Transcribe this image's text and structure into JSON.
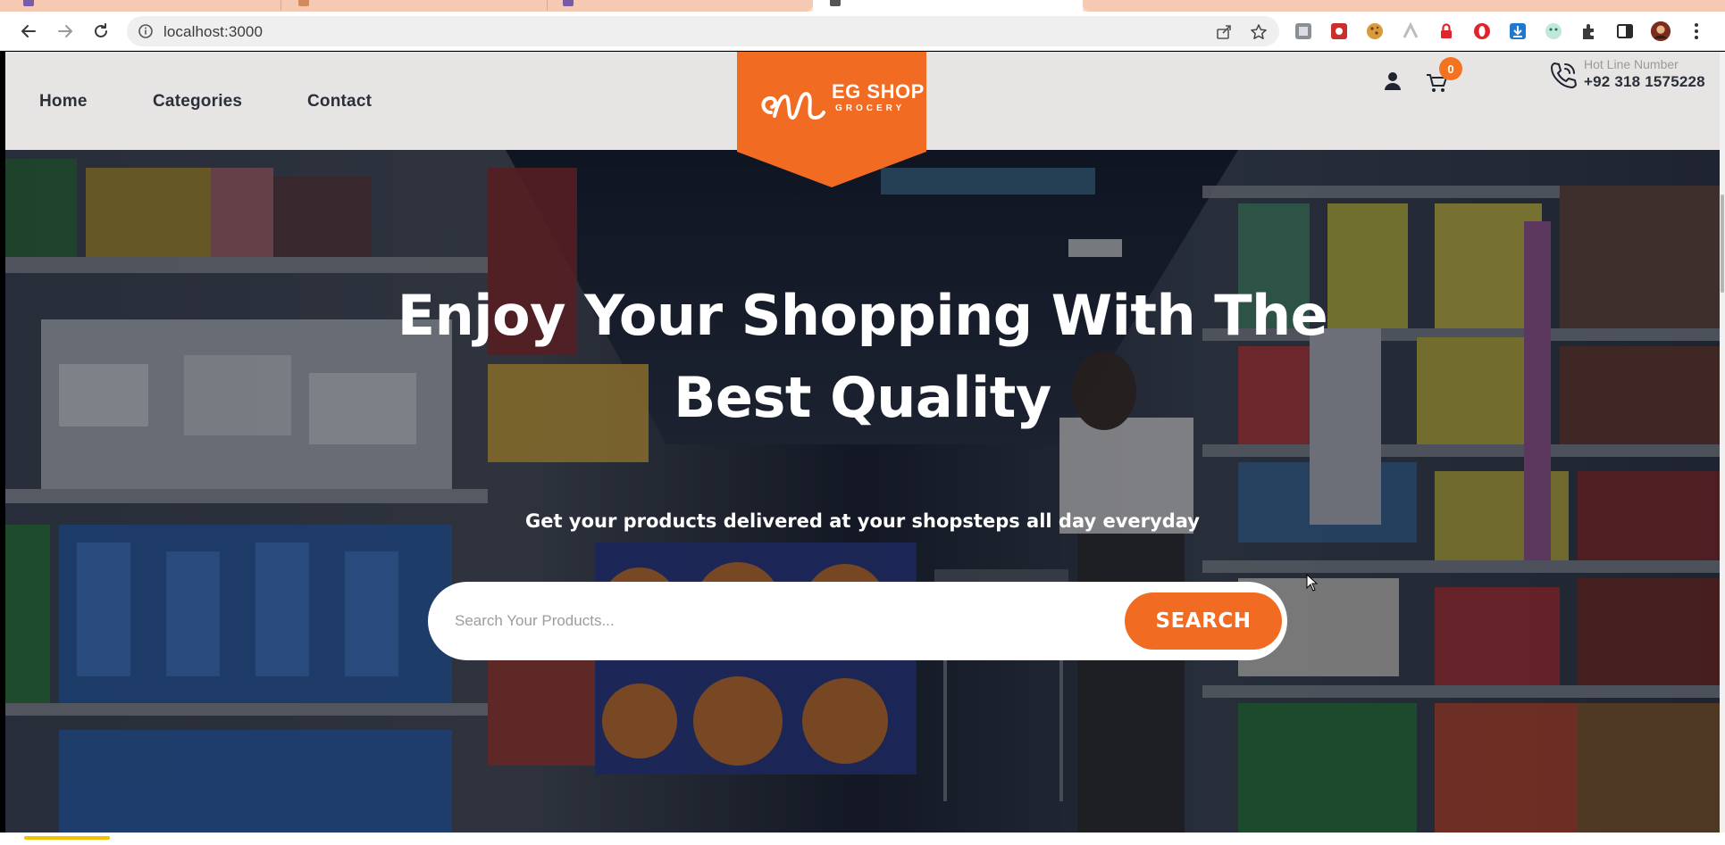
{
  "browser": {
    "url": "localhost:3000"
  },
  "site": {
    "nav": [
      {
        "label": "Home"
      },
      {
        "label": "Categories"
      },
      {
        "label": "Contact"
      }
    ],
    "logo": {
      "line1": "EG SHOP",
      "line2": "GROCERY"
    },
    "cart_count": "0",
    "hotline": {
      "label": "Hot Line Number",
      "number": "+92 318 1575228"
    }
  },
  "hero": {
    "title_line1": "Enjoy Your Shopping With The",
    "title_line2": "Best Quality",
    "subtitle": "Get your products delivered at your shopsteps all day everyday",
    "search_placeholder": "Search Your Products...",
    "search_button": "SEARCH"
  },
  "colors": {
    "accent": "#f26b23",
    "header_bg": "#e6e5e3",
    "text_dark": "#2b2f3a"
  }
}
